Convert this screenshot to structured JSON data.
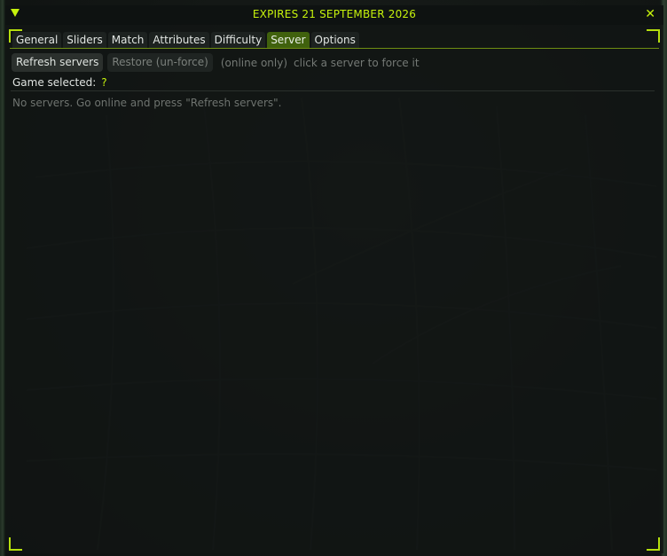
{
  "window": {
    "title": "EXPIRES 21 SEPTEMBER 2026",
    "close_glyph": "✕",
    "accent_color": "#c6f20c"
  },
  "tabs": [
    {
      "label": "General",
      "active": false
    },
    {
      "label": "Sliders",
      "active": false
    },
    {
      "label": "Match",
      "active": false
    },
    {
      "label": "Attributes",
      "active": false
    },
    {
      "label": "Difficulty",
      "active": false
    },
    {
      "label": "Server",
      "active": true
    },
    {
      "label": "Options",
      "active": false
    }
  ],
  "toolbar": {
    "refresh_label": "Refresh servers",
    "restore_label": "Restore (un-force)",
    "online_hint": "(online only)",
    "force_hint": "click a server to force it"
  },
  "game": {
    "label": "Game selected:",
    "value": "?"
  },
  "servers": {
    "empty_message": "No servers. Go online and press \"Refresh servers\"."
  }
}
